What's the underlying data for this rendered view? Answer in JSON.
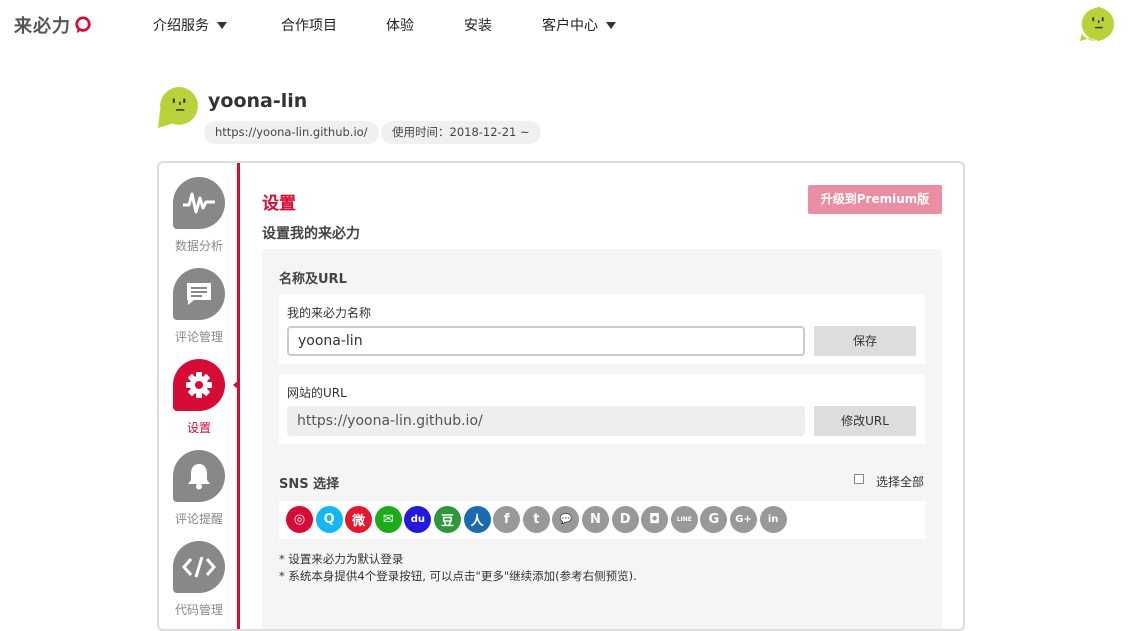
{
  "brand": {
    "logo_text": "来必力",
    "accent": "#d60c36",
    "avatar_color": "#b9d23a"
  },
  "nav": {
    "items": [
      {
        "label": "介绍服务",
        "dropdown": true
      },
      {
        "label": "合作项目",
        "dropdown": false
      },
      {
        "label": "体验",
        "dropdown": false
      },
      {
        "label": "安装",
        "dropdown": false
      },
      {
        "label": "客户中心",
        "dropdown": true
      }
    ]
  },
  "profile": {
    "name": "yoona-lin",
    "url": "https://yoona-lin.github.io/",
    "since": "使用时间：2018-12-21 ~"
  },
  "sidebar": {
    "items": [
      {
        "label": "数据分析",
        "icon": "pulse-icon",
        "active": false
      },
      {
        "label": "评论管理",
        "icon": "comment-icon",
        "active": false
      },
      {
        "label": "设置",
        "icon": "gear-icon",
        "active": true
      },
      {
        "label": "评论提醒",
        "icon": "bell-icon",
        "active": false
      },
      {
        "label": "代码管理",
        "icon": "code-icon",
        "active": false
      }
    ]
  },
  "main": {
    "title": "设置",
    "premium_button": "升级到Premium版",
    "subtitle": "设置我的来必力",
    "name_url_section": {
      "title": "名称及URL",
      "name_label": "我的来必力名称",
      "name_value": "yoona-lin",
      "save_button": "保存",
      "url_label": "网站的URL",
      "url_value": "https://yoona-lin.github.io/",
      "edit_url_button": "修改URL"
    },
    "sns": {
      "title": "SNS 选择",
      "select_all": "选择全部",
      "icons": [
        {
          "name": "livere-icon",
          "color": "#d60c36",
          "glyph": "◎"
        },
        {
          "name": "qq-icon",
          "color": "#12b7f5",
          "glyph": "Q"
        },
        {
          "name": "weibo-icon",
          "color": "#e6162d",
          "glyph": "微"
        },
        {
          "name": "wechat-icon",
          "color": "#1aad19",
          "glyph": "✉"
        },
        {
          "name": "baidu-icon",
          "color": "#2319dc",
          "glyph": "du"
        },
        {
          "name": "douban-icon",
          "color": "#2e963d",
          "glyph": "豆"
        },
        {
          "name": "renren-icon",
          "color": "#1c6bb0",
          "glyph": "人"
        },
        {
          "name": "facebook-icon",
          "color": "#999999",
          "glyph": "f"
        },
        {
          "name": "twitter-icon",
          "color": "#999999",
          "glyph": "t"
        },
        {
          "name": "kakaotalk-icon",
          "color": "#999999",
          "glyph": "💬"
        },
        {
          "name": "naver-icon",
          "color": "#999999",
          "glyph": "N"
        },
        {
          "name": "daum-icon",
          "color": "#999999",
          "glyph": "D"
        },
        {
          "name": "instagram-icon",
          "color": "#999999",
          "glyph": "◘"
        },
        {
          "name": "line-icon",
          "color": "#999999",
          "glyph": "LINE"
        },
        {
          "name": "github-icon",
          "color": "#999999",
          "glyph": "G"
        },
        {
          "name": "google-plus-icon",
          "color": "#999999",
          "glyph": "G+"
        },
        {
          "name": "linkedin-icon",
          "color": "#999999",
          "glyph": "in"
        }
      ]
    },
    "notes": [
      "* 设置来必力为默认登录",
      "* 系统本身提供4个登录按钮, 可以点击\"更多\"继续添加(参考右侧预览)."
    ]
  }
}
